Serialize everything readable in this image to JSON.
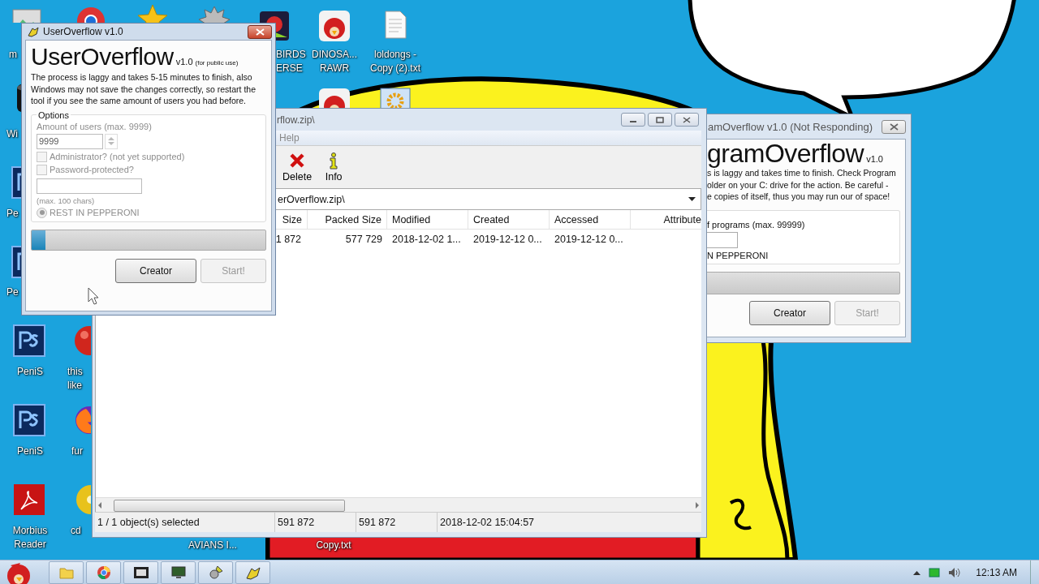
{
  "desktop_icons": [
    {
      "label": "m"
    },
    {
      "label": "BIRDS\nERSE"
    },
    {
      "label": "DINOSA...\nRAWR"
    },
    {
      "label": "loldongs -\nCopy (2).txt"
    },
    {
      "label": "Wi"
    },
    {
      "label": "Pe"
    },
    {
      "label": "Pe"
    },
    {
      "label": "PeniS"
    },
    {
      "label": "PeniS"
    },
    {
      "label": "Morbius\nReader"
    },
    {
      "label": "this\nlike"
    },
    {
      "label": "fur"
    },
    {
      "label": "cd"
    },
    {
      "label": "AVIANS I..."
    },
    {
      "label": "Copy.txt"
    }
  ],
  "user_window": {
    "title": "UserOverflow v1.0",
    "heading": "UserOverflow",
    "version": "v1.0",
    "note": "(for public use)",
    "description": "The process is laggy and takes 5-15 minutes to finish, also Windows may not save the changes correctly, so restart the tool if you see the same amount of users you had before.",
    "options": {
      "legend": "Options",
      "disabled": true,
      "amount_label": "Amount of users (max. 9999)",
      "amount_value": "9999",
      "checkboxes": [
        {
          "label": "Administrator? (not yet supported)",
          "checked": false
        },
        {
          "label": "Password-protected?",
          "checked": false
        }
      ],
      "hint": "(max. 100 chars)",
      "radio": {
        "label": "REST IN PEPPERONI",
        "selected": true
      }
    },
    "progress": {
      "level": 0.06
    },
    "buttons": [
      {
        "label": "Creator",
        "disabled": false
      },
      {
        "label": "Start!",
        "disabled": true
      }
    ]
  },
  "archive_window": {
    "title": "rflow.zip\\",
    "menu": [
      "Help"
    ],
    "toolbar": [
      {
        "label": "Delete",
        "kind": "delete"
      },
      {
        "label": "Info",
        "kind": "info"
      }
    ],
    "address": "erOverflow.zip\\",
    "columns": [
      "Size",
      "Packed Size",
      "Modified",
      "Created",
      "Accessed",
      "Attribute"
    ],
    "rows": [
      {
        "cells": [
          "1 872",
          "577 729",
          "2018-12-02 1...",
          "2019-12-12 0...",
          "2019-12-12 0...",
          null
        ]
      }
    ],
    "status": [
      "1 / 1 object(s) selected",
      "591 872",
      "591 872",
      "2018-12-02 15:04:57"
    ]
  },
  "program_window": {
    "title": "amOverflow v1.0 (Not Responding)",
    "heading": "gramOverflow",
    "version": "v1.0",
    "description_lines": [
      "s is laggy and takes time to finish. Check Program",
      "older on your C: drive for the action. Be careful -",
      "e copies of itself, thus you may run our of space!"
    ],
    "amount_label": "f programs (max. 99999)",
    "radio_label": "N PEPPERONI",
    "buttons": [
      {
        "label": "Creator",
        "disabled": false
      },
      {
        "label": "Start!",
        "disabled": true
      }
    ]
  },
  "taskbar": {
    "clock": "12:13 AM"
  }
}
